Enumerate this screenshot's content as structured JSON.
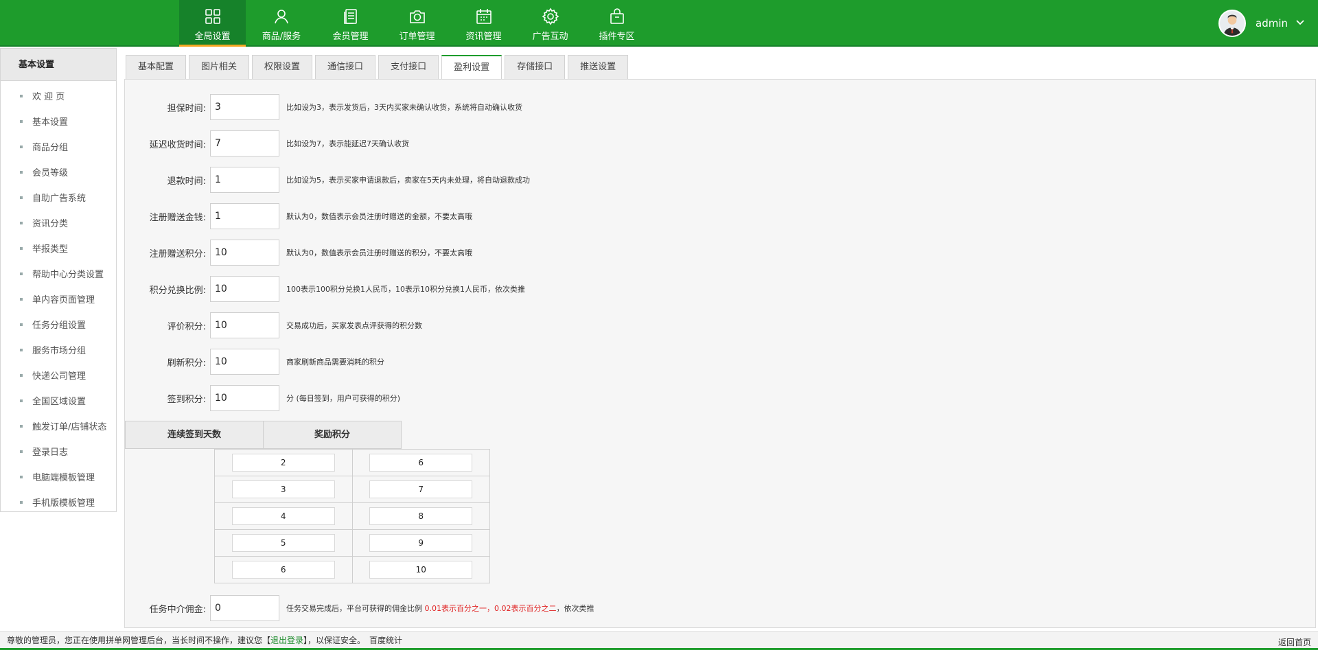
{
  "nav": {
    "items": [
      {
        "label": "全局设置",
        "icon": "grid-icon"
      },
      {
        "label": "商品/服务",
        "icon": "user-icon"
      },
      {
        "label": "会员管理",
        "icon": "book-icon"
      },
      {
        "label": "订单管理",
        "icon": "camera-icon"
      },
      {
        "label": "资讯管理",
        "icon": "calendar-icon"
      },
      {
        "label": "广告互动",
        "icon": "gear-icon"
      },
      {
        "label": "插件专区",
        "icon": "bag-icon"
      }
    ],
    "active": 0
  },
  "user": {
    "name": "admin"
  },
  "sidebar": {
    "title": "基本设置",
    "items": [
      "欢 迎 页",
      "基本设置",
      "商品分组",
      "会员等级",
      "自助广告系统",
      "资讯分类",
      "举报类型",
      "帮助中心分类设置",
      "单内容页面管理",
      "任务分组设置",
      "服务市场分组",
      "快递公司管理",
      "全国区域设置",
      "触发订单/店铺状态",
      "登录日志",
      "电脑端模板管理",
      "手机版模板管理"
    ]
  },
  "tabs": {
    "items": [
      "基本配置",
      "图片相关",
      "权限设置",
      "通信接口",
      "支付接口",
      "盈利设置",
      "存储接口",
      "推送设置"
    ],
    "active": 5
  },
  "form": {
    "rows": [
      {
        "label": "担保时间:",
        "value": "3",
        "hint": "比如设为3，表示发货后，3天内买家未确认收货，系统将自动确认收货"
      },
      {
        "label": "延迟收货时间:",
        "value": "7",
        "hint": "比如设为7，表示能延迟7天确认收货"
      },
      {
        "label": "退款时间:",
        "value": "1",
        "hint": "比如设为5，表示买家申请退款后，卖家在5天内未处理，将自动退款成功"
      },
      {
        "label": "注册赠送金钱:",
        "value": "1",
        "hint": "默认为0，数值表示会员注册时赠送的金额，不要太高哦"
      },
      {
        "label": "注册赠送积分:",
        "value": "10",
        "hint": "默认为0，数值表示会员注册时赠送的积分，不要太高哦"
      },
      {
        "label": "积分兑换比例:",
        "value": "10",
        "hint": "100表示100积分兑换1人民币，10表示10积分兑换1人民币，依次类推"
      },
      {
        "label": "评价积分:",
        "value": "10",
        "hint": "交易成功后，买家发表点评获得的积分数"
      },
      {
        "label": "刷新积分:",
        "value": "10",
        "hint": "商家刷新商品需要消耗的积分"
      },
      {
        "label": "签到积分:",
        "value": "10",
        "hint": "分 (每日签到，用户可获得的积分)"
      }
    ],
    "sign_table": {
      "headers": [
        "连续签到天数",
        "奖励积分"
      ],
      "rows": [
        [
          "2",
          "6"
        ],
        [
          "3",
          "7"
        ],
        [
          "4",
          "8"
        ],
        [
          "5",
          "9"
        ],
        [
          "6",
          "10"
        ]
      ]
    },
    "commission": {
      "label": "任务中介佣金:",
      "value": "0",
      "hint_prefix": "任务交易完成后，平台可获得的佣金比例",
      "hint_red": "0.01表示百分之一，0.02表示百分之二",
      "hint_suffix": "，依次类推"
    }
  },
  "footer": {
    "text_prefix": "尊敬的管理员，您正在使用拼单网管理后台，当长时间不操作，建议您【",
    "logout": "退出登录",
    "text_suffix": "】，以保证安全。",
    "stats": "百度统计",
    "home": "返回首页"
  },
  "colors": {
    "brand": "#1e9c2c",
    "accent": "#f5a623",
    "hint_red": "#e02020"
  }
}
